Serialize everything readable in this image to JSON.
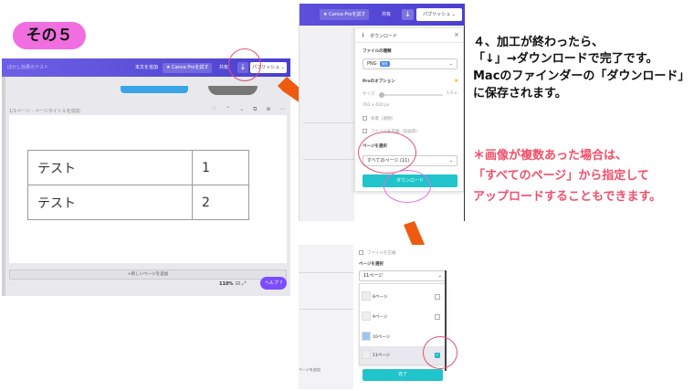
{
  "badge": {
    "label": "その５"
  },
  "left_shot": {
    "topbar": {
      "ghost_text": "ぼかし効果のテスト",
      "trial_label": "本文を追加",
      "pro_label": "★ Canva Proを試す",
      "share_label": "共有",
      "download_icon": "↓",
      "publish_label": "パブリッシュ ⌄"
    },
    "page_label": "1/1ページ - ページタイトルを追加",
    "page_icons": "♡ ⌃ ⌄ ⧉ ⊕ ⋯",
    "table": [
      [
        "テスト",
        "1"
      ],
      [
        "テスト",
        "2"
      ]
    ],
    "add_page": "+新しいページを追加",
    "zoom": "110%",
    "zoom_icons": "⊟ ⤢",
    "help": "ヘルプ ?"
  },
  "mid_shot": {
    "topbar": {
      "pro_label": "★ Canva Proを試す",
      "share_label": "共有",
      "download_icon": "↓",
      "publish_label": "パブリッシュ ⌄"
    },
    "panel": {
      "title": "ダウンロード",
      "close": "×",
      "title_icon": "↓",
      "filetype_label": "ファイルの種類",
      "filetype_value": "PNG",
      "filetype_tag": "推奨",
      "pro_options": "Proのオプション",
      "star": "★",
      "size_label": "サイズ",
      "size_value": "1.0 x",
      "dimensions": "762 x 420 px",
      "option1": "背景（透明）",
      "option2": "ファイルを圧縮（低画質）",
      "page_select_label": "ページを選択",
      "page_select_value": "すべてのページ (11)",
      "download_button": "ダウンロード"
    }
  },
  "bottom_shot": {
    "compress_option": "ファイルを圧縮",
    "page_select_label": "ページを選択",
    "page_select_value": "11ページ",
    "pages": [
      {
        "label": "8ページ",
        "checked": false
      },
      {
        "label": "9ページ",
        "checked": false
      },
      {
        "label": "10ページ",
        "checked": false
      },
      {
        "label": "11ページ",
        "checked": true
      }
    ],
    "add_page": "ページを追加",
    "done_button": "完了"
  },
  "instructions": {
    "line1": "４、加工が終わったら、",
    "line2": "「↓」→ダウンロードで完了です。",
    "line3": "Macのファインダーの「ダウンロード」",
    "line4": "に保存されます。"
  },
  "note": {
    "line1": "＊画像が複数あった場合は、",
    "line2": "「すべてのページ」から指定して",
    "line3": "アップロードすることもできます。"
  },
  "colors": {
    "accent_pink": "#f06ee0",
    "note_red": "#f0506a",
    "arrow_orange": "#ee5a10",
    "canva_purple": "#5a4ed8",
    "canva_teal": "#20c4cb"
  }
}
